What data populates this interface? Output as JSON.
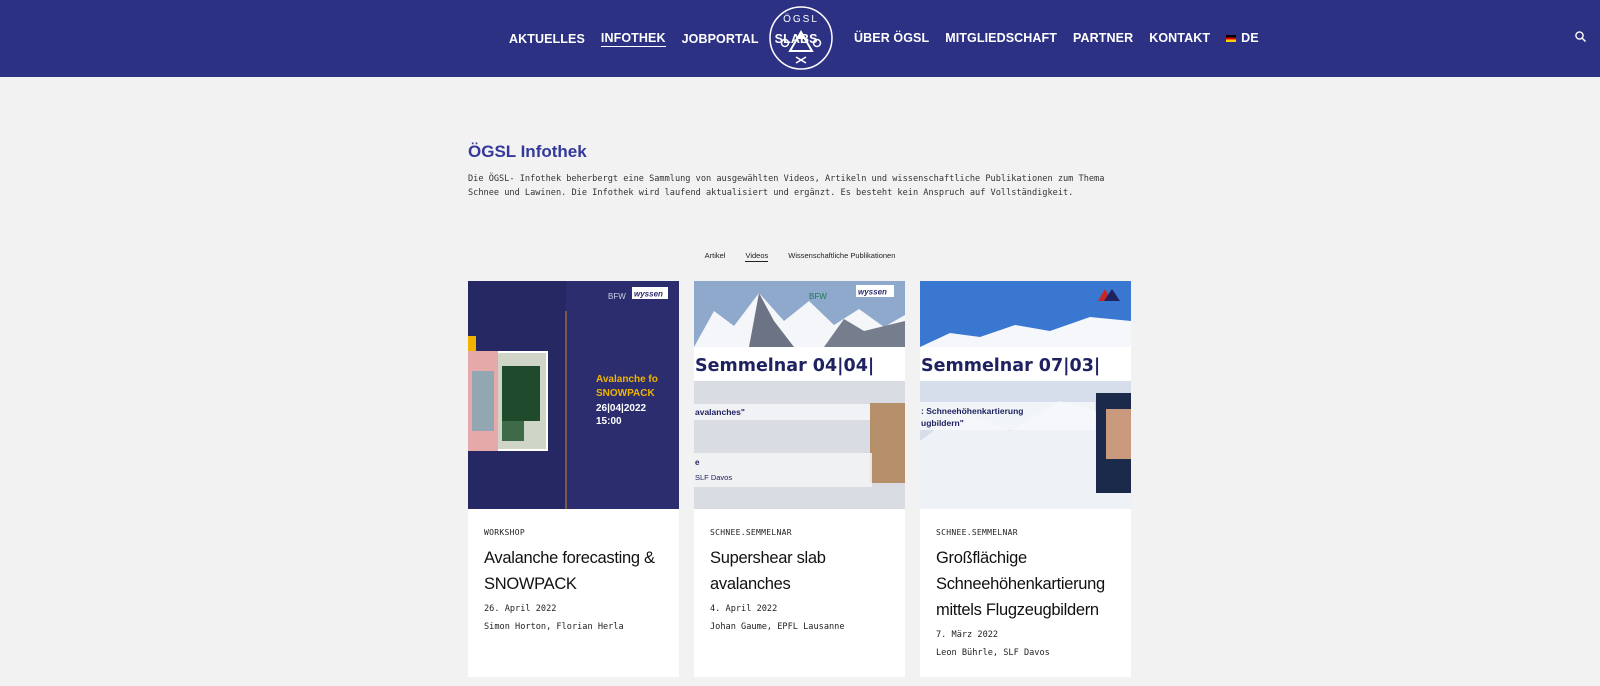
{
  "nav": {
    "left": [
      "AKTUELLES",
      "INFOTHEK",
      "JOBPORTAL",
      "SLABS"
    ],
    "right": [
      "ÜBER ÖGSL",
      "MITGLIEDSCHAFT",
      "PARTNER",
      "KONTAKT"
    ],
    "lang": "DE",
    "logo_text": "ÖGSL",
    "active": "INFOTHEK"
  },
  "page": {
    "title": "ÖGSL Infothek",
    "intro": "Die ÖGSL- Infothek beherbergt eine Sammlung von ausgewählten Videos, Artikeln und wissenschaftliche Publikationen zum Thema Schnee und Lawinen.  Die Infothek wird laufend aktualisiert und ergänzt. Es besteht kein Anspruch auf Vollständigkeit."
  },
  "filters": [
    "Artikel",
    "Videos",
    "Wissenschaftliche Publikationen"
  ],
  "active_filter": "Videos",
  "cards": [
    {
      "category": "WORKSHOP",
      "title": "Avalanche forecasting & SNOWPACK",
      "date": "26. April 2022",
      "author": "Simon Horton, Florian Herla",
      "thumb": {
        "logo1": "BFW",
        "logo2": "wyssen",
        "headline": "Avalanche fo",
        "headline2": "SNOWPACK",
        "line3": "26|04|2022",
        "line4": "15:00"
      }
    },
    {
      "category": "SCHNEE.SEMMELNAR",
      "title": "Supershear slab avalanches",
      "date": "4. April 2022",
      "author": "Johan Gaume, EPFL Lausanne",
      "thumb": {
        "logo1": "BFW",
        "logo2": "wyssen",
        "banner": "Semmelnar 04|04|",
        "quote": "avalanches\"",
        "sub1": "e",
        "sub2": "SLF Davos"
      }
    },
    {
      "category": "SCHNEE.SEMMELNAR",
      "title": "Großflächige Schneehöhenkartierung mittels Flugzeugbildern",
      "date": "7. März 2022",
      "author": "Leon Bührle, SLF Davos",
      "thumb": {
        "banner": "Semmelnar 07|03|",
        "quote1": ": Schneehöhenkartierung",
        "quote2": "ugbildern\""
      }
    }
  ],
  "colors": {
    "header": "#2d3184",
    "title": "#34389a",
    "background": "#f2f2f2",
    "banner_text": "#1f2260",
    "accent_yellow": "#f0b400"
  },
  "icons": {
    "search": "search-icon",
    "flag": "german-flag-icon"
  }
}
